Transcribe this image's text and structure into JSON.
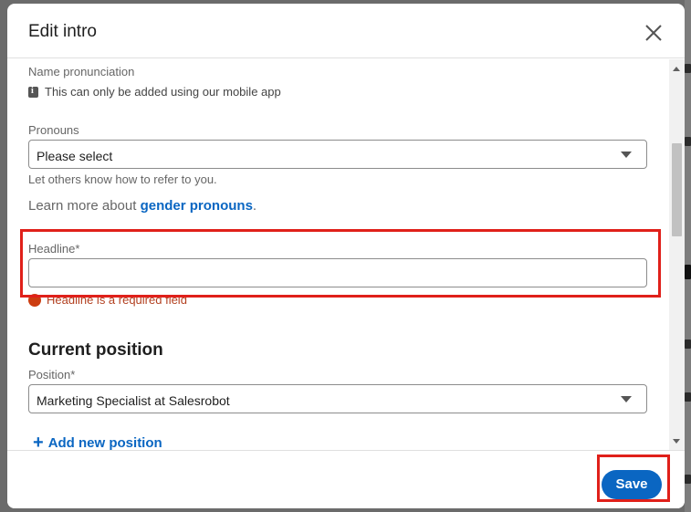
{
  "dialog": {
    "title": "Edit intro",
    "close_icon": "close-icon"
  },
  "name_pronunciation": {
    "label": "Name pronunciation",
    "info_text": "This can only be added using our mobile app",
    "icon": "info-icon"
  },
  "pronouns": {
    "label": "Pronouns",
    "selected": "Please select",
    "helper": "Let others know how to refer to you.",
    "learn_more_prefix": "Learn more about ",
    "learn_more_link": "gender pronouns",
    "learn_more_suffix": "."
  },
  "headline": {
    "label": "Headline*",
    "value": "",
    "error": "Headline is a required field"
  },
  "current_position": {
    "section_title": "Current position",
    "label": "Position*",
    "selected": "Marketing Specialist at Salesrobot",
    "add_label": "Add new position"
  },
  "footer": {
    "save_label": "Save"
  },
  "colors": {
    "accent": "#0a66c2",
    "error": "#cc3d10",
    "highlight": "#e0201a"
  }
}
